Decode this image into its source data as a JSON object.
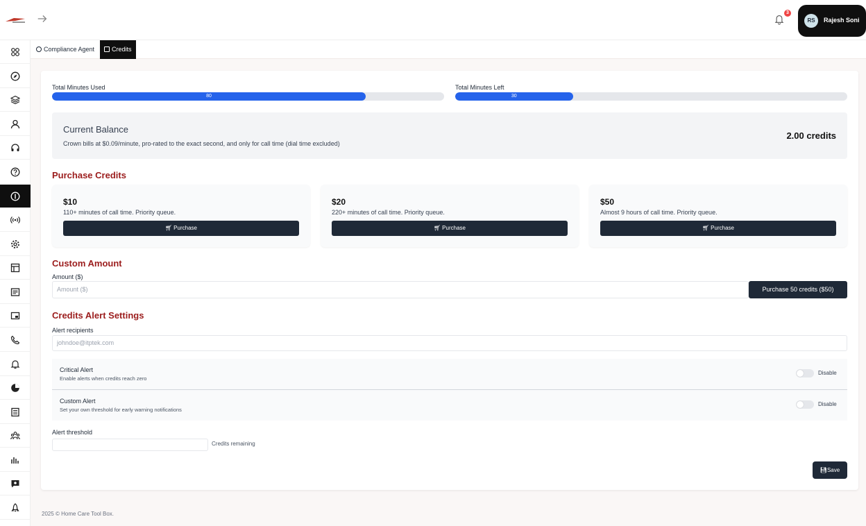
{
  "header": {
    "notification_count": "3",
    "user": {
      "initials": "RS",
      "name": "Rajesh Soni"
    }
  },
  "sidebar": {
    "items": [
      {
        "icon": "apps-icon"
      },
      {
        "icon": "compass-icon"
      },
      {
        "icon": "layers-icon"
      },
      {
        "icon": "user-icon"
      },
      {
        "icon": "headset-icon"
      },
      {
        "icon": "help-circle-icon"
      },
      {
        "icon": "info-circle-icon",
        "active": true
      },
      {
        "icon": "broadcast-icon"
      },
      {
        "icon": "settings-icon"
      },
      {
        "icon": "layout-icon"
      },
      {
        "icon": "newspaper-icon"
      },
      {
        "icon": "picture-in-picture-icon"
      },
      {
        "icon": "phone-icon"
      },
      {
        "icon": "bell-icon"
      },
      {
        "icon": "pie-chart-icon"
      },
      {
        "icon": "document-list-icon"
      },
      {
        "icon": "team-icon"
      },
      {
        "icon": "bar-chart-icon"
      },
      {
        "icon": "message-icon"
      },
      {
        "icon": "rocket-icon"
      }
    ]
  },
  "tabs": [
    {
      "label": "Compliance Agent",
      "active": false
    },
    {
      "label": "Credits",
      "active": true
    }
  ],
  "usage": {
    "used_label": "Total Minutes Used",
    "used_value": "80",
    "used_fraction": 0.8,
    "left_label": "Total Minutes Left",
    "left_value": "30",
    "left_fraction": 0.3
  },
  "balance": {
    "title": "Current Balance",
    "description": "Crown bills at $0.09/minute, pro-rated to the exact second, and only for call time (dial time excluded)",
    "value": "2.00 credits"
  },
  "purchase": {
    "title": "Purchase Credits",
    "plans": [
      {
        "price": "$10",
        "description": "110+ minutes of call time. Priority queue.",
        "button": "Purchase"
      },
      {
        "price": "$20",
        "description": "220+ minutes of call time. Priority queue.",
        "button": "Purchase"
      },
      {
        "price": "$50",
        "description": "Almost 9 hours of call time. Priority queue.",
        "button": "Purchase"
      }
    ]
  },
  "custom": {
    "title": "Custom Amount",
    "label": "Amount ($)",
    "placeholder": "Amount ($)",
    "button": "Purchase 50 credits ($50)"
  },
  "alerts": {
    "title": "Credits Alert Settings",
    "recipients_label": "Alert recipients",
    "recipients_placeholder": "johndoe@itptek.com",
    "critical": {
      "title": "Critical Alert",
      "description": "Enable alerts when credits reach zero",
      "state": "Disable"
    },
    "custom": {
      "title": "Custom Alert",
      "description": "Set your own threshold for early warning notifications",
      "state": "Disable"
    },
    "threshold_label": "Alert threshold",
    "threshold_suffix": "Credits remaining",
    "save": "Save"
  },
  "footer": "2025 © Home Care Tool Box.",
  "colors": {
    "accent": "#2563eb",
    "section_title": "#9b1c1c",
    "dark": "#1f2937",
    "badge": "#ef4444"
  }
}
